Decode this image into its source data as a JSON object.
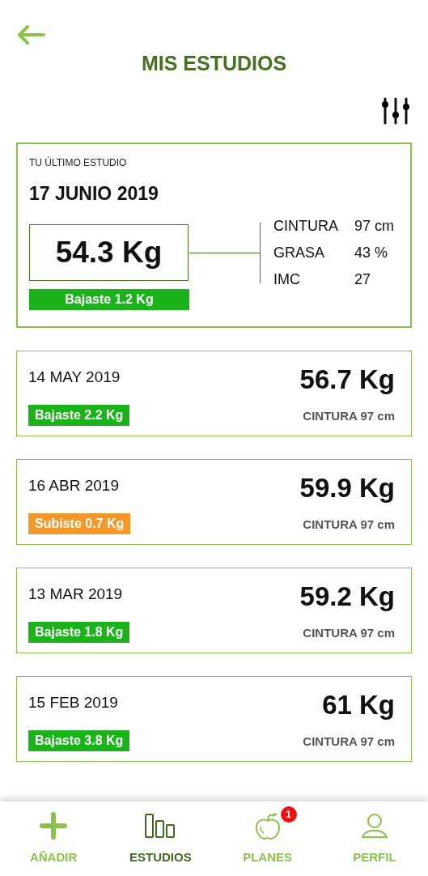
{
  "header": {
    "title": "MIS ESTUDIOS"
  },
  "latest": {
    "label": "TU ÚLTIMO ESTUDIO",
    "date": "17 JUNIO 2019",
    "weight": "54.3 Kg",
    "change": {
      "kind": "down",
      "text": "Bajaste 1.2 Kg"
    },
    "metrics": [
      {
        "name": "CINTURA",
        "value": "97 cm"
      },
      {
        "name": "GRASA",
        "value": "43 %"
      },
      {
        "name": "IMC",
        "value": "27"
      }
    ]
  },
  "studies": [
    {
      "date": "14 MAY 2019",
      "weight": "56.7 Kg",
      "change": {
        "kind": "down",
        "text": "Bajaste 2.2 Kg"
      },
      "waist": "CINTURA 97 cm"
    },
    {
      "date": "16 ABR 2019",
      "weight": "59.9 Kg",
      "change": {
        "kind": "up",
        "text": "Subiste 0.7 Kg"
      },
      "waist": "CINTURA 97 cm"
    },
    {
      "date": "13 MAR 2019",
      "weight": "59.2 Kg",
      "change": {
        "kind": "down",
        "text": "Bajaste 1.8 Kg"
      },
      "waist": "CINTURA 97 cm"
    },
    {
      "date": "15 FEB 2019",
      "weight": "61 Kg",
      "change": {
        "kind": "down",
        "text": "Bajaste 3.8 Kg"
      },
      "waist": "CINTURA 97 cm"
    }
  ],
  "nav": [
    {
      "label": "AÑADIR",
      "kind": "plus",
      "selected": false
    },
    {
      "label": "ESTUDIOS",
      "kind": "bars",
      "selected": true
    },
    {
      "label": "PLANES",
      "kind": "apple",
      "selected": false,
      "badge": "1"
    },
    {
      "label": "PERFIL",
      "kind": "user",
      "selected": false
    }
  ]
}
